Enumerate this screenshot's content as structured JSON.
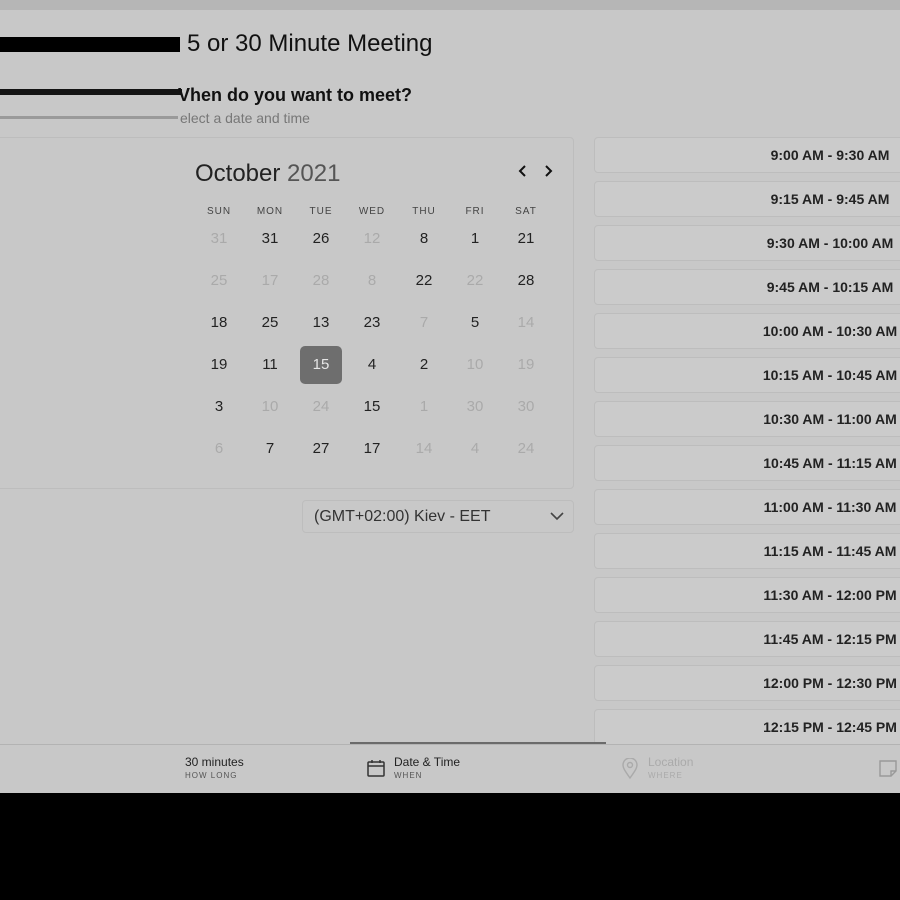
{
  "header": {
    "title": "5 or 30 Minute Meeting",
    "question": "Vhen do you want to meet?",
    "subtitle": "elect a date and time"
  },
  "calendar": {
    "month": "October",
    "year": "2021",
    "prev_label": "‹",
    "next_label": "›",
    "weekdays": [
      "SUN",
      "MON",
      "TUE",
      "WED",
      "THU",
      "FRI",
      "SAT"
    ],
    "weeks": [
      [
        {
          "d": "31",
          "dim": true
        },
        {
          "d": "31",
          "dim": false
        },
        {
          "d": "26",
          "dim": false
        },
        {
          "d": "12",
          "dim": true
        },
        {
          "d": "8",
          "dim": false
        },
        {
          "d": "1",
          "dim": false
        },
        {
          "d": "21",
          "dim": false
        }
      ],
      [
        {
          "d": "25",
          "dim": true
        },
        {
          "d": "17",
          "dim": true
        },
        {
          "d": "28",
          "dim": true
        },
        {
          "d": "8",
          "dim": true
        },
        {
          "d": "22",
          "dim": false
        },
        {
          "d": "22",
          "dim": true
        },
        {
          "d": "28",
          "dim": false
        }
      ],
      [
        {
          "d": "18",
          "dim": false
        },
        {
          "d": "25",
          "dim": false
        },
        {
          "d": "13",
          "dim": false
        },
        {
          "d": "23",
          "dim": false
        },
        {
          "d": "7",
          "dim": true
        },
        {
          "d": "5",
          "dim": false
        },
        {
          "d": "14",
          "dim": true
        }
      ],
      [
        {
          "d": "19",
          "dim": false
        },
        {
          "d": "11",
          "dim": false
        },
        {
          "d": "15",
          "dim": false,
          "selected": true
        },
        {
          "d": "4",
          "dim": false
        },
        {
          "d": "2",
          "dim": false
        },
        {
          "d": "10",
          "dim": true
        },
        {
          "d": "19",
          "dim": true
        }
      ],
      [
        {
          "d": "3",
          "dim": false
        },
        {
          "d": "10",
          "dim": true
        },
        {
          "d": "24",
          "dim": true
        },
        {
          "d": "15",
          "dim": false
        },
        {
          "d": "1",
          "dim": true
        },
        {
          "d": "30",
          "dim": true
        },
        {
          "d": "30",
          "dim": true
        }
      ],
      [
        {
          "d": "6",
          "dim": true
        },
        {
          "d": "7",
          "dim": false
        },
        {
          "d": "27",
          "dim": false
        },
        {
          "d": "17",
          "dim": false
        },
        {
          "d": "14",
          "dim": true
        },
        {
          "d": "4",
          "dim": true
        },
        {
          "d": "24",
          "dim": true
        }
      ]
    ]
  },
  "timezone": {
    "label": "(GMT+02:00) Kiev - EET",
    "icon": "chevron-down-icon"
  },
  "time_slots": [
    "9:00 AM - 9:30 AM",
    "9:15 AM - 9:45 AM",
    "9:30 AM - 10:00 AM",
    "9:45 AM - 10:15 AM",
    "10:00 AM - 10:30 AM",
    "10:15 AM - 10:45 AM",
    "10:30 AM - 11:00 AM",
    "10:45 AM - 11:15 AM",
    "11:00 AM - 11:30 AM",
    "11:15 AM - 11:45 AM",
    "11:30 AM - 12:00 PM",
    "11:45 AM - 12:15 PM",
    "12:00 PM - 12:30 PM",
    "12:15 PM - 12:45 PM"
  ],
  "steps": [
    {
      "main": "30 minutes",
      "sub": "HOW LONG",
      "icon": null
    },
    {
      "main": "Date & Time",
      "sub": "WHEN",
      "icon": "calendar-icon"
    },
    {
      "main": "Location",
      "sub": "WHERE",
      "icon": "location-pin-icon"
    },
    {
      "main": "",
      "sub": "",
      "icon": "note-icon"
    }
  ],
  "colors": {
    "background": "#c8c8c8",
    "selected_day": "#6e6e6e",
    "progress": "#6b6b6b"
  }
}
